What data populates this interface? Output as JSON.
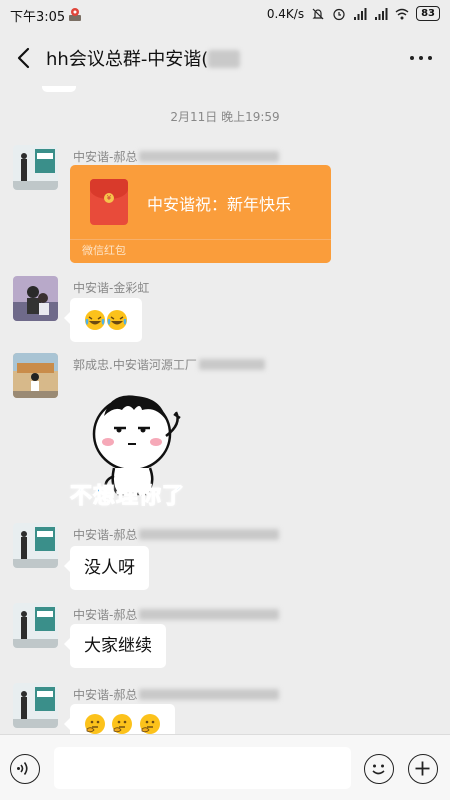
{
  "status": {
    "time": "下午3:05",
    "speed": "0.4K/s",
    "battery": "83"
  },
  "header": {
    "title": "hh会议总群-中安谐("
  },
  "timestamp": "2月11日 晚上19:59",
  "messages": [
    {
      "sender": "中安谐-郝总",
      "type": "red-packet",
      "text": "中安谐祝：新年快乐",
      "footer": "微信红包"
    },
    {
      "sender": "中安谐-金彩虹",
      "type": "emoji",
      "count": 2
    },
    {
      "sender": "郭成忠.中安谐河源工厂",
      "type": "sticker",
      "caption": "不想理你了"
    },
    {
      "sender": "中安谐-郝总",
      "type": "text",
      "text": "没人呀"
    },
    {
      "sender": "中安谐-郝总",
      "type": "text",
      "text": "大家继续"
    },
    {
      "sender": "中安谐-郝总",
      "type": "emoji",
      "count": 3
    }
  ],
  "icons": {
    "back": "back-arrow-icon",
    "more": "more-dots-icon",
    "voice": "voice-icon",
    "emoji": "emoji-icon",
    "plus": "plus-icon"
  },
  "colors": {
    "background": "#ededed",
    "red_packet": "#fa9d3b",
    "sticker_text": "#1a8fe6"
  }
}
